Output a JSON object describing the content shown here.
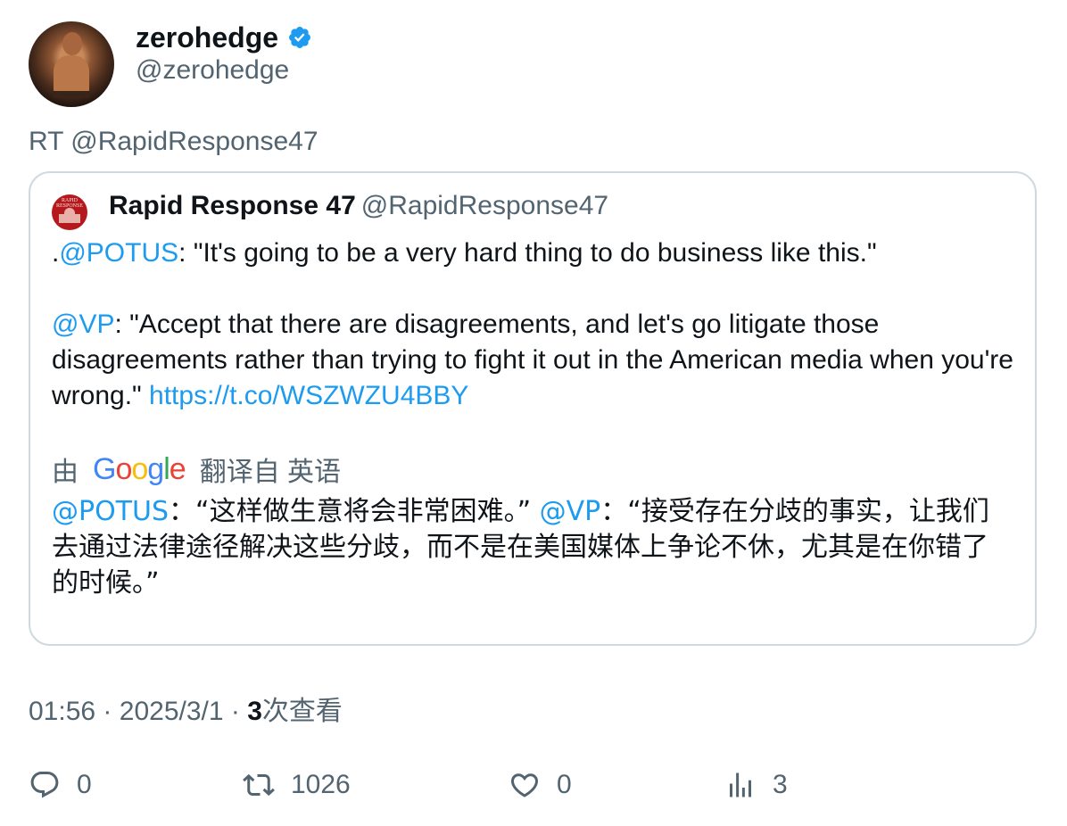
{
  "author": {
    "display_name": "zerohedge",
    "handle": "@zerohedge",
    "avatar_icon": "avatar-photo",
    "verified_color": "#1d9bf0"
  },
  "retweet_line": "RT @RapidResponse47",
  "quoted": {
    "display_name": "Rapid Response 47",
    "handle": "@RapidResponse47",
    "body": {
      "line1_prefix": ".",
      "line1_mention": "@POTUS",
      "line1_text": ": \"It's going to be a very hard thing to do business like this.\"",
      "line2_mention": "@VP",
      "line2_text": ": \"Accept that there are disagreements, and let's go litigate those disagreements rather than trying to fight it out in the American media when you're wrong.\" ",
      "link": "https://t.co/WSZWZU4BBY"
    },
    "translation": {
      "by": "由",
      "provider": "Google",
      "label": "翻译自 英语",
      "mention1": "@POTUS",
      "text1": "：“这样做生意将会非常困难。” ",
      "mention2": "@VP",
      "text2": "：“接受存在分歧的事实，让我们去通过法律途径解决这些分歧，而不是在美国媒体上争论不休，尤其是在你错了的时候。”"
    }
  },
  "meta": {
    "time": "01:56",
    "sep": "·",
    "date": "2025/3/1",
    "views_count": "3",
    "views_label": "次查看"
  },
  "actions": {
    "reply_count": "0",
    "retweet_count": "1026",
    "like_count": "0",
    "views_count": "3"
  },
  "colors": {
    "accent": "#1d9bf0",
    "secondary_text": "#536471",
    "border": "#cfd9de"
  }
}
